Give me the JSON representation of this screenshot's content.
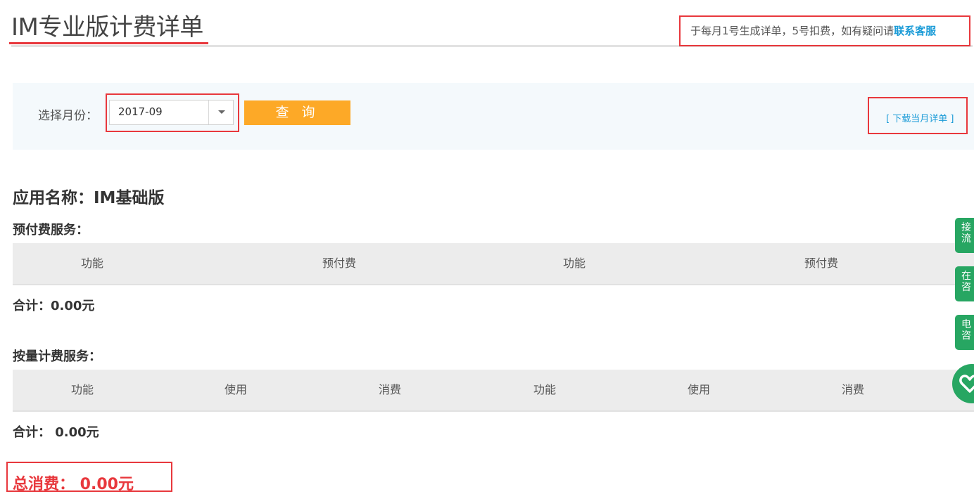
{
  "header": {
    "title": "IM专业版计费详单",
    "notice_text": "于每月1号生成详单，5号扣费，如有疑问请",
    "notice_link": "联系客服"
  },
  "filter": {
    "label": "选择月份：",
    "selected_month": "2017-09",
    "query_label": "查 询",
    "download_label": "[ 下载当月详单 ]"
  },
  "app": {
    "name": "应用名称：IM基础版"
  },
  "prepaid": {
    "title": "预付费服务：",
    "columns": [
      "功能",
      "预付费",
      "功能",
      "预付费"
    ],
    "total": "合计：0.00元"
  },
  "usage": {
    "title": "按量计费服务：",
    "columns": [
      "功能",
      "使用",
      "消费",
      "功能",
      "使用",
      "消费"
    ],
    "total": "合计： 0.00元"
  },
  "grand_total": "总消费： 0.00元",
  "side_panel": {
    "tabs": [
      "接流",
      "在咨",
      "电咨"
    ],
    "color": "#27a662"
  },
  "colors": {
    "accent_orange": "#fda927",
    "link_blue": "#1a9bd7",
    "highlight_red": "#e8383d"
  }
}
